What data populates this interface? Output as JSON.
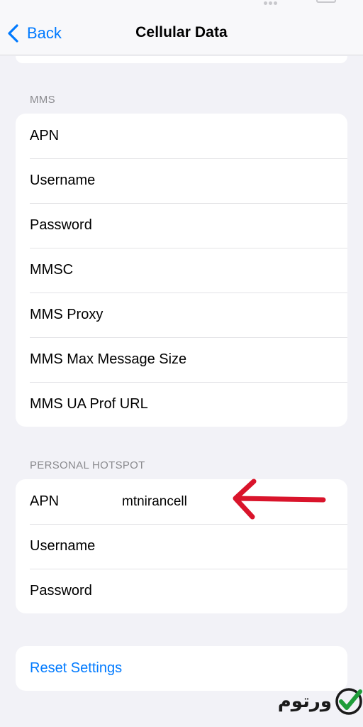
{
  "nav": {
    "back_label": "Back",
    "title": "Cellular Data"
  },
  "mms": {
    "header": "MMS",
    "rows": [
      {
        "label": "APN"
      },
      {
        "label": "Username"
      },
      {
        "label": "Password"
      },
      {
        "label": "MMSC"
      },
      {
        "label": "MMS Proxy"
      },
      {
        "label": "MMS Max Message Size"
      },
      {
        "label": "MMS UA Prof URL"
      }
    ]
  },
  "hotspot": {
    "header": "PERSONAL HOTSPOT",
    "rows": [
      {
        "label": "APN",
        "value": "mtnirancell"
      },
      {
        "label": "Username"
      },
      {
        "label": "Password"
      }
    ]
  },
  "reset": {
    "label": "Reset Settings"
  },
  "watermark": {
    "text": "ورتوم"
  },
  "colors": {
    "accent": "#007aff",
    "annotation_arrow": "#d9142b",
    "check": "#1f9d3a"
  }
}
